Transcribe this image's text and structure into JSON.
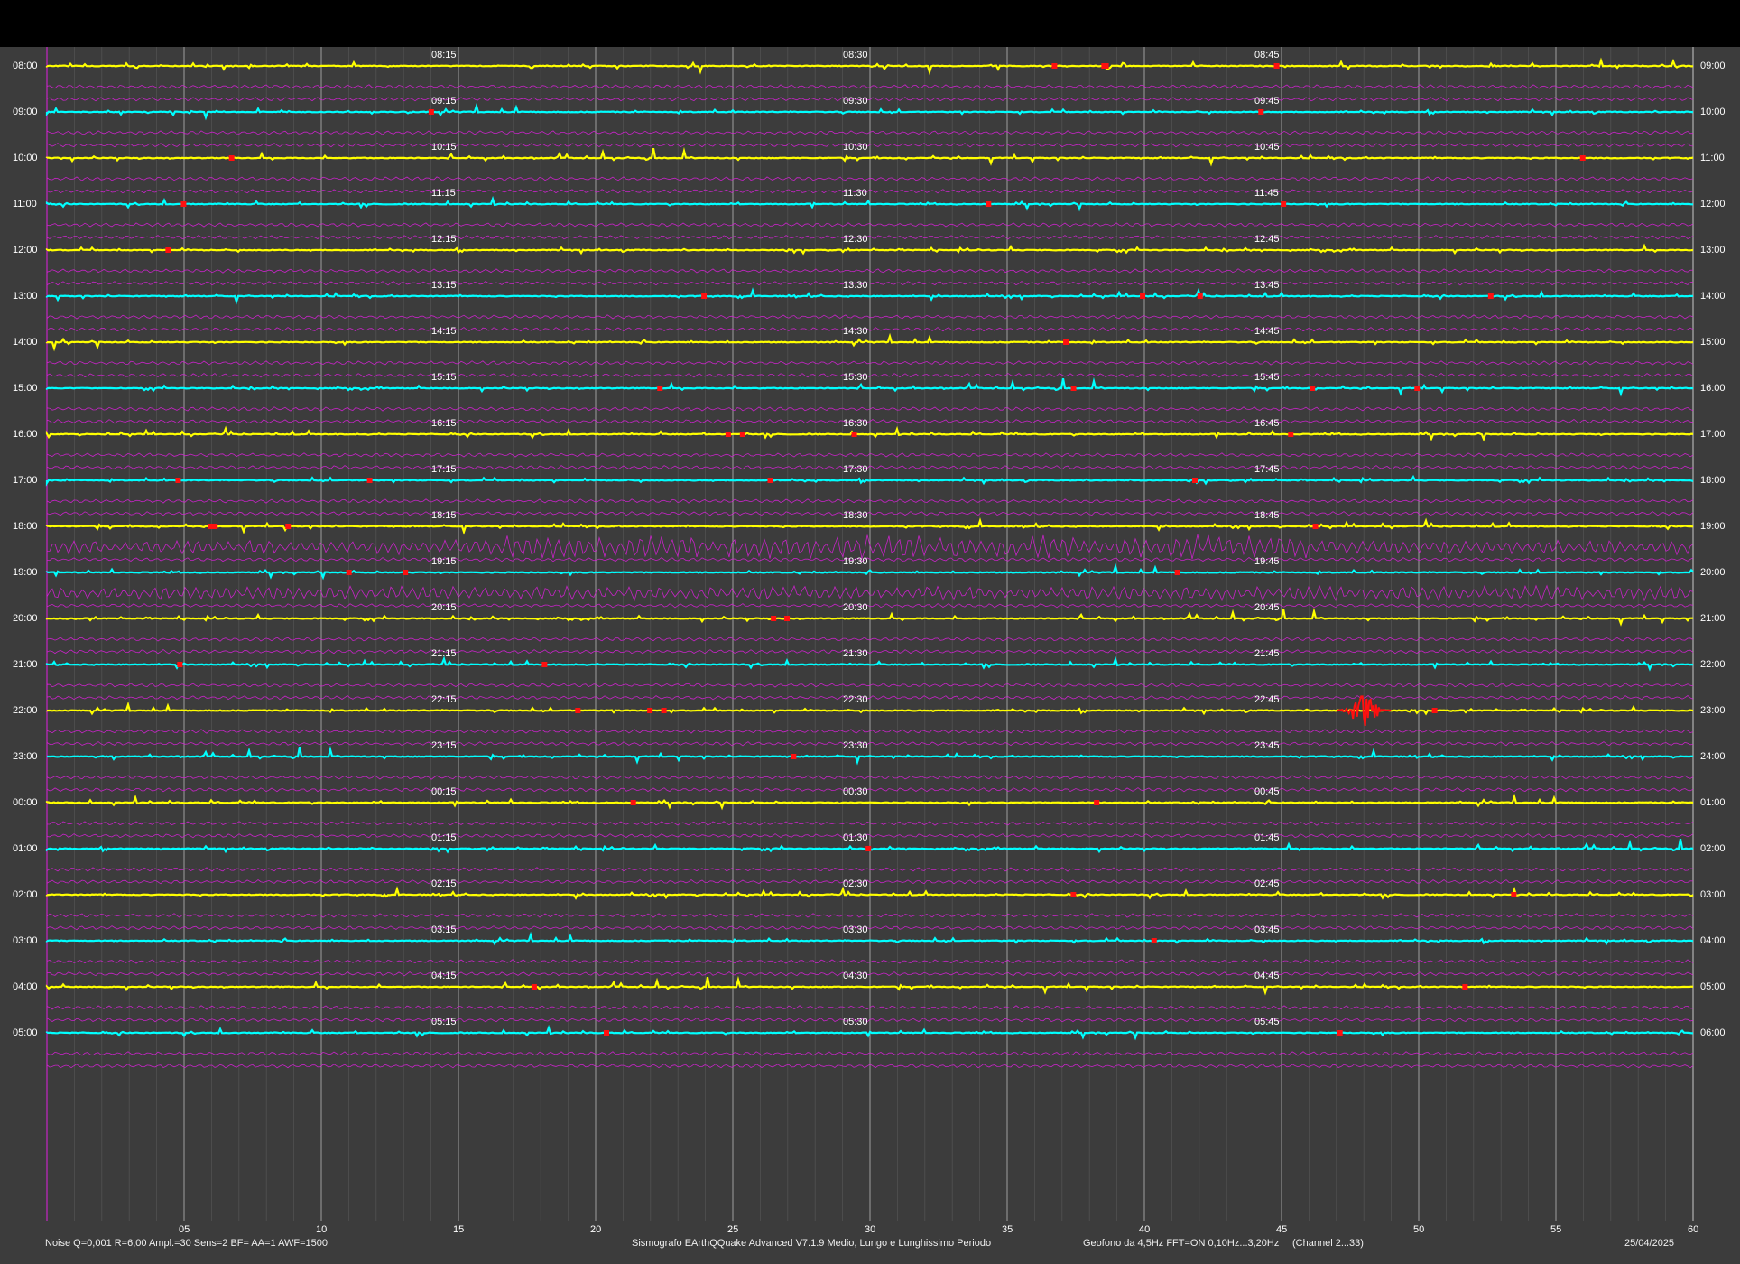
{
  "window": {
    "title": ""
  },
  "rows": [
    {
      "left": "08:00",
      "right": "09:00",
      "marks": [
        "08:15",
        "08:30",
        "08:45"
      ],
      "color": "yellow"
    },
    {
      "left": "09:00",
      "right": "10:00",
      "marks": [
        "09:15",
        "09:30",
        "09:45"
      ],
      "color": "cyan"
    },
    {
      "left": "10:00",
      "right": "11:00",
      "marks": [
        "10:15",
        "10:30",
        "10:45"
      ],
      "color": "yellow"
    },
    {
      "left": "11:00",
      "right": "12:00",
      "marks": [
        "11:15",
        "11:30",
        "11:45"
      ],
      "color": "cyan"
    },
    {
      "left": "12:00",
      "right": "13:00",
      "marks": [
        "12:15",
        "12:30",
        "12:45"
      ],
      "color": "yellow"
    },
    {
      "left": "13:00",
      "right": "14:00",
      "marks": [
        "13:15",
        "13:30",
        "13:45"
      ],
      "color": "cyan"
    },
    {
      "left": "14:00",
      "right": "15:00",
      "marks": [
        "14:15",
        "14:30",
        "14:45"
      ],
      "color": "yellow"
    },
    {
      "left": "15:00",
      "right": "16:00",
      "marks": [
        "15:15",
        "15:30",
        "15:45"
      ],
      "color": "cyan"
    },
    {
      "left": "16:00",
      "right": "17:00",
      "marks": [
        "16:15",
        "16:30",
        "16:45"
      ],
      "color": "yellow"
    },
    {
      "left": "17:00",
      "right": "18:00",
      "marks": [
        "17:15",
        "17:30",
        "17:45"
      ],
      "color": "cyan"
    },
    {
      "left": "18:00",
      "right": "19:00",
      "marks": [
        "18:15",
        "18:30",
        "18:45"
      ],
      "color": "yellow"
    },
    {
      "left": "19:00",
      "right": "20:00",
      "marks": [
        "19:15",
        "19:30",
        "19:45"
      ],
      "color": "cyan"
    },
    {
      "left": "20:00",
      "right": "21:00",
      "marks": [
        "20:15",
        "20:30",
        "20:45"
      ],
      "color": "yellow"
    },
    {
      "left": "21:00",
      "right": "22:00",
      "marks": [
        "21:15",
        "21:30",
        "21:45"
      ],
      "color": "cyan"
    },
    {
      "left": "22:00",
      "right": "23:00",
      "marks": [
        "22:15",
        "22:30",
        "22:45"
      ],
      "color": "yellow"
    },
    {
      "left": "23:00",
      "right": "24:00",
      "marks": [
        "23:15",
        "23:30",
        "23:45"
      ],
      "color": "cyan"
    },
    {
      "left": "00:00",
      "right": "01:00",
      "marks": [
        "00:15",
        "00:30",
        "00:45"
      ],
      "color": "yellow"
    },
    {
      "left": "01:00",
      "right": "02:00",
      "marks": [
        "01:15",
        "01:30",
        "01:45"
      ],
      "color": "cyan"
    },
    {
      "left": "02:00",
      "right": "03:00",
      "marks": [
        "02:15",
        "02:30",
        "02:45"
      ],
      "color": "yellow"
    },
    {
      "left": "03:00",
      "right": "04:00",
      "marks": [
        "03:15",
        "03:30",
        "03:45"
      ],
      "color": "cyan"
    },
    {
      "left": "04:00",
      "right": "05:00",
      "marks": [
        "04:15",
        "04:30",
        "04:45"
      ],
      "color": "yellow"
    },
    {
      "left": "05:00",
      "right": "06:00",
      "marks": [
        "05:15",
        "05:30",
        "05:45"
      ],
      "color": "cyan"
    }
  ],
  "x_axis": {
    "ticks": [
      "05",
      "10",
      "15",
      "20",
      "25",
      "30",
      "35",
      "40",
      "45",
      "50",
      "55",
      "60"
    ]
  },
  "footer": {
    "settings": "Noise Q=0,001 R=6,00 Ampl.=30 Sens=2 BF= AA=1 AWF=1500",
    "app": "Sismografo  EArthQQuake Advanced V7.1.9  Medio, Lungo e Lunghissimo Periodo",
    "sensor": "Geofono da 4,5Hz FFT=ON 0,10Hz...3,20Hz",
    "channel": "(Channel 2...33)",
    "date": "25/04/2025"
  },
  "colors": {
    "background": "#3c3c3c",
    "titlebar": "#000000",
    "grid_major": "#c8c8c8",
    "grid_minor": "#646464",
    "trace_yellow": "#ffff00",
    "trace_cyan": "#00ffff",
    "trace_magenta": "#e020e0",
    "event_red": "#ff1010"
  }
}
